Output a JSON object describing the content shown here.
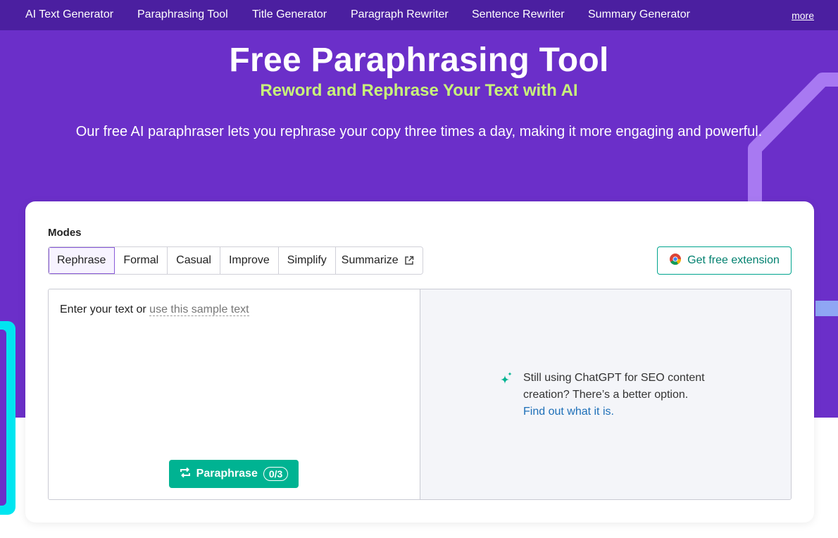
{
  "nav": {
    "items": [
      "AI Text Generator",
      "Paraphrasing Tool",
      "Title Generator",
      "Paragraph Rewriter",
      "Sentence Rewriter",
      "Summary Generator"
    ],
    "more": "more"
  },
  "hero": {
    "title": "Free Paraphrasing Tool",
    "subtitle": "Reword and Rephrase Your Text with AI",
    "description": "Our free AI paraphraser lets you rephrase your copy three times a day, making it more engaging and powerful."
  },
  "tool": {
    "modes_label": "Modes",
    "modes": [
      "Rephrase",
      "Formal",
      "Casual",
      "Improve",
      "Simplify",
      "Summarize"
    ],
    "active_mode": "Rephrase",
    "extension_button": "Get free extension",
    "placeholder_prefix": "Enter your text or",
    "sample_link": "use this sample text",
    "paraphrase_button": "Paraphrase",
    "usage_counter": "0/3",
    "promo_text": "Still using ChatGPT for SEO content creation? There’s a better option.",
    "promo_link": "Find out what it is."
  },
  "colors": {
    "nav_bg": "#4b1fa0",
    "hero_bg": "#6b2fc9",
    "subtitle": "#c8f27a",
    "accent_green": "#00b392",
    "link_blue": "#1d6fb8"
  },
  "icons": [
    "chrome-icon",
    "external-link-icon",
    "repeat-icon",
    "sparkle-icon"
  ]
}
